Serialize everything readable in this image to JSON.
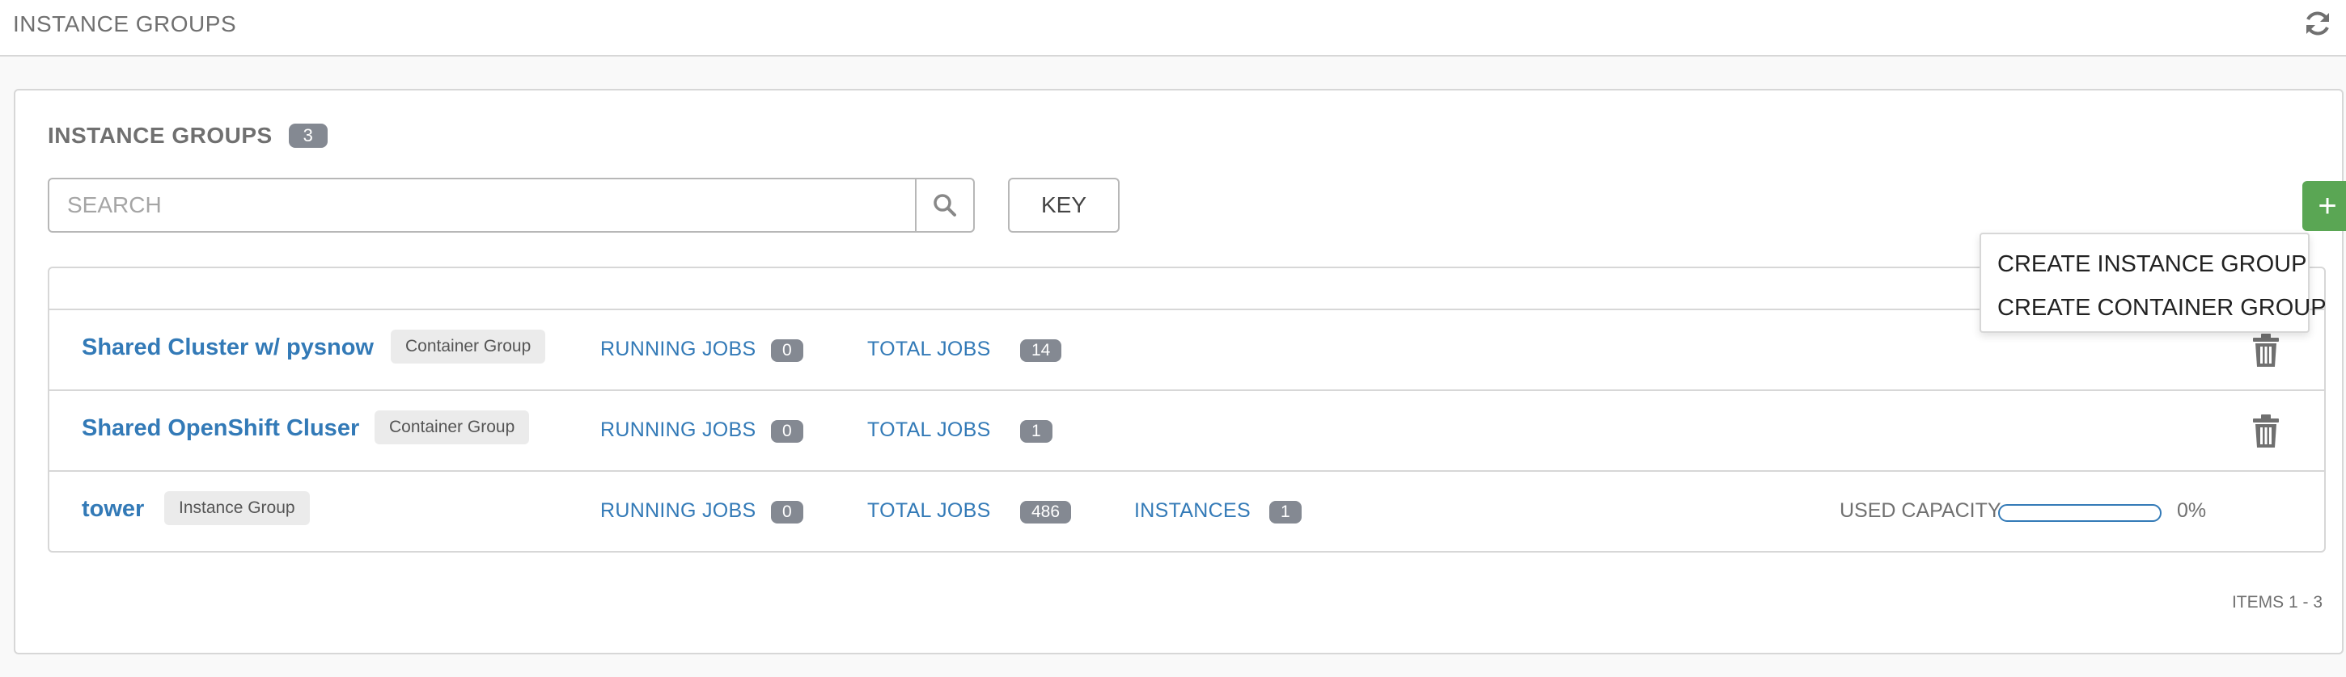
{
  "breadcrumb": {
    "title": "INSTANCE GROUPS"
  },
  "icons": {
    "refresh": "refresh-icon",
    "search": "search-icon",
    "trash": "trash-icon",
    "add": "plus-icon"
  },
  "colors": {
    "link": "#337ab7",
    "add_button": "#5aa654",
    "badge": "#848992",
    "tag": "#ebebeb"
  },
  "panel": {
    "title": "INSTANCE GROUPS",
    "count": "3",
    "search_placeholder": "SEARCH",
    "key_label": "KEY",
    "add_label": "+"
  },
  "dropdown": {
    "items": [
      "CREATE INSTANCE GROUP",
      "CREATE CONTAINER GROUP"
    ]
  },
  "rows": [
    {
      "name": "Shared Cluster w/ pysnow",
      "type": "Container Group",
      "running_label": "RUNNING JOBS",
      "running": "0",
      "total_label": "TOTAL JOBS",
      "total": "14"
    },
    {
      "name": "Shared OpenShift Cluser",
      "type": "Container Group",
      "running_label": "RUNNING JOBS",
      "running": "0",
      "total_label": "TOTAL JOBS",
      "total": "1"
    },
    {
      "name": "tower",
      "type": "Instance Group",
      "running_label": "RUNNING JOBS",
      "running": "0",
      "total_label": "TOTAL JOBS",
      "total": "486",
      "instances_label": "INSTANCES",
      "instances": "1",
      "capacity_label": "USED CAPACITY",
      "capacity_pct": "0%",
      "capacity_fraction": 0
    }
  ],
  "footer": {
    "items": "ITEMS  1 - 3"
  }
}
